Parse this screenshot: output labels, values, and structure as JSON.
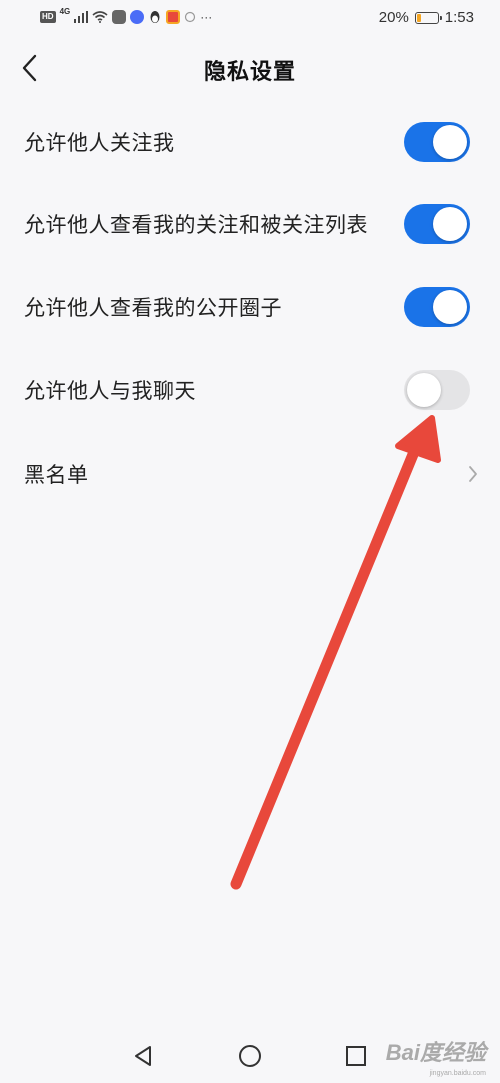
{
  "status_bar": {
    "hd": "HD",
    "network": "4G",
    "battery_percent": "20%",
    "battery_level": 0.2,
    "time": "1:53",
    "more": "···"
  },
  "header": {
    "title": "隐私设置",
    "back_icon": "chevron-left-icon"
  },
  "settings": [
    {
      "label": "允许他人关注我",
      "enabled": true
    },
    {
      "label": "允许他人查看我的关注和被关注列表",
      "enabled": true
    },
    {
      "label": "允许他人查看我的公开圈子",
      "enabled": true
    },
    {
      "label": "允许他人与我聊天",
      "enabled": false
    }
  ],
  "blacklist": {
    "label": "黑名单",
    "icon": "chevron-right-icon"
  },
  "colors": {
    "toggle_on": "#1a73e8",
    "toggle_off": "#e4e4e6",
    "arrow": "#e8483b"
  },
  "nav_bar": {
    "back": "triangle-back-icon",
    "home": "circle-home-icon",
    "recent": "square-recent-icon"
  },
  "watermark": {
    "main": "Bai度经验",
    "sub": "jingyan.baidu.com"
  }
}
